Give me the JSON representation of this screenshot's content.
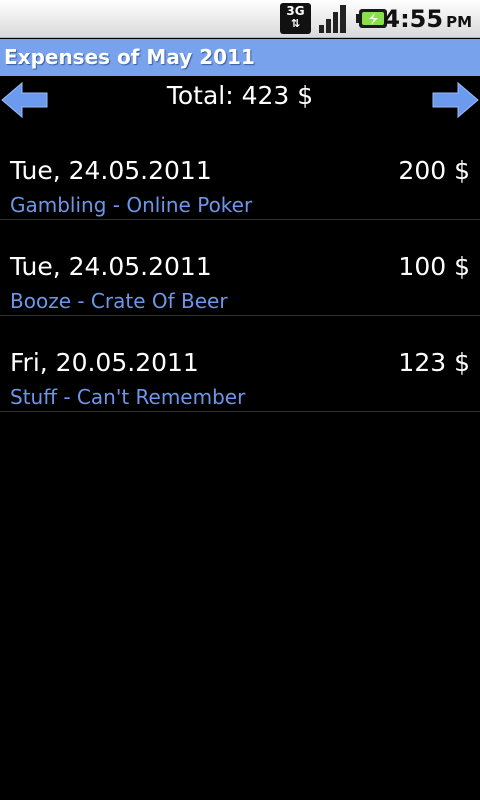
{
  "status_bar": {
    "network_label": "3G",
    "time": "4:55",
    "ampm": "PM"
  },
  "title": "Expenses of May 2011",
  "nav": {
    "total": "Total: 423 $",
    "prev_icon": "arrow-left-icon",
    "next_icon": "arrow-right-icon"
  },
  "expenses": [
    {
      "date": "Tue, 24.05.2011",
      "amount": "200 $",
      "description": "Gambling - Online Poker"
    },
    {
      "date": "Tue, 24.05.2011",
      "amount": "100 $",
      "description": "Booze - Crate Of Beer"
    },
    {
      "date": "Fri, 20.05.2011",
      "amount": "123 $",
      "description": "Stuff - Can't Remember"
    }
  ],
  "colors": {
    "title_bar": "#78a3ec",
    "accent_text": "#6e96e8",
    "arrow": "#6b9aef",
    "background": "#000000"
  }
}
